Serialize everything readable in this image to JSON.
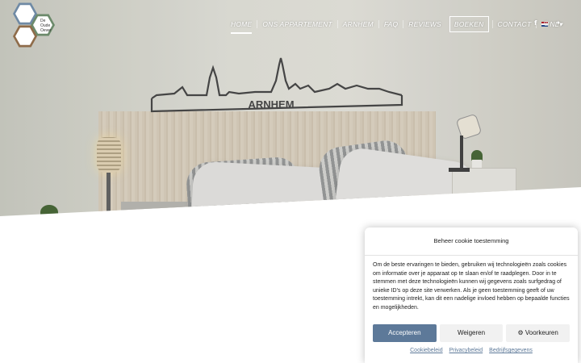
{
  "logo": {
    "text_line1": "De",
    "text_line2": "Oude",
    "text_line3": "Oever"
  },
  "hero": {
    "wall_text": "ARNHEM"
  },
  "nav": {
    "items": [
      {
        "label": "Home",
        "active": true
      },
      {
        "label": "Ons appartement"
      },
      {
        "label": "Arnhem"
      },
      {
        "label": "FAQ"
      },
      {
        "label": "Reviews"
      },
      {
        "label": "Boeken",
        "boxed": true
      },
      {
        "label": "Contact"
      }
    ],
    "language": "NL",
    "language_caret": "▾"
  },
  "socials": {
    "facebook": "f",
    "instagram": "◎",
    "twitter": "✦"
  },
  "cookie": {
    "title": "Beheer cookie toestemming",
    "body": "Om de beste ervaringen te bieden, gebruiken wij technologieën zoals cookies om informatie over je apparaat op te slaan en/of te raadplegen. Door in te stemmen met deze technologieën kunnen wij gegevens zoals surfgedrag of unieke ID's op deze site verwerken. Als je geen toestemming geeft of uw toestemming intrekt, kan dit een nadelige invloed hebben op bepaalde functies en mogelijkheden.",
    "accept_label": "Accepteren",
    "deny_label": "Weigeren",
    "prefs_label": "⚙ Voorkeuren",
    "links": [
      "Cookiebeleid",
      "Privacybeleid",
      "Bedrijfsgegevens"
    ]
  },
  "colors": {
    "accent": "#5d7999",
    "nav_text": "#ffffff"
  }
}
